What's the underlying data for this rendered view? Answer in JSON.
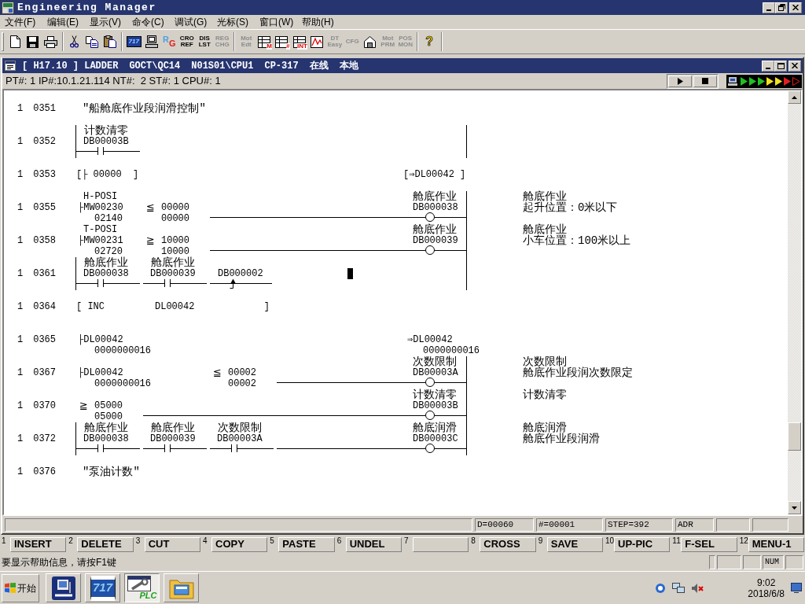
{
  "window": {
    "title": "Engineering Manager"
  },
  "menu": [
    "文件(F)",
    "编辑(E)",
    "显示(V)",
    "命令(C)",
    "调试(G)",
    "光标(S)",
    "窗口(W)",
    "帮助(H)"
  ],
  "toolbar": {
    "groups": [
      {
        "items": [
          {
            "kind": "new",
            "disabled": false
          },
          {
            "kind": "save",
            "disabled": false
          },
          {
            "kind": "print",
            "disabled": false
          }
        ]
      },
      {
        "items": [
          {
            "kind": "cut",
            "disabled": false
          },
          {
            "kind": "copy",
            "disabled": false
          },
          {
            "kind": "paste",
            "disabled": false
          }
        ]
      },
      {
        "items": [
          {
            "kind": "tile",
            "label": "717",
            "disabled": false
          },
          {
            "kind": "terminal",
            "disabled": false
          },
          {
            "kind": "letters",
            "label": "RG",
            "disabled": false
          },
          {
            "kind": "text",
            "lines": [
              "CRO",
              "REF"
            ],
            "disabled": false
          },
          {
            "kind": "text",
            "lines": [
              "DIS",
              "LST"
            ],
            "disabled": false
          },
          {
            "kind": "text",
            "lines": [
              "REG",
              "CHG"
            ],
            "disabled": true
          }
        ]
      },
      {
        "items": [
          {
            "kind": "text",
            "lines": [
              "Mot",
              "Edt"
            ],
            "disabled": true
          },
          {
            "kind": "grid",
            "label": "M",
            "disabled": false
          },
          {
            "kind": "grid",
            "label": "#",
            "disabled": false
          },
          {
            "kind": "grid",
            "label": "INT",
            "disabled": false
          },
          {
            "kind": "trend",
            "disabled": false
          },
          {
            "kind": "text",
            "lines": [
              "DT",
              "Easy"
            ],
            "disabled": true
          },
          {
            "kind": "text",
            "lines": [
              "CFG"
            ],
            "disabled": true
          },
          {
            "kind": "house",
            "disabled": false
          },
          {
            "kind": "text",
            "lines": [
              "Mot",
              "PRM"
            ],
            "disabled": true
          },
          {
            "kind": "text",
            "lines": [
              "POS",
              "MON"
            ],
            "disabled": true
          }
        ]
      },
      {
        "items": [
          {
            "kind": "help",
            "label": "?",
            "disabled": false
          }
        ]
      }
    ]
  },
  "document": {
    "title_parts": [
      "[ H17.10 ] LADDER",
      "GOCT\\QC14",
      "N01S01\\CPU1",
      "CP-317",
      "在线",
      "本地"
    ],
    "connection": "PT#: 1 IP#:10.1.21.114 NT#:  2 ST#: 1 CPU#: 1",
    "ladder": {
      "rows": [
        {
          "pt": "1",
          "step": "0351",
          "kind": "comment",
          "text": "″船舱底作业段润滑控制″",
          "left_rail": false,
          "right_rail": false,
          "cursor": false
        },
        {
          "pt": "1",
          "step": "0352",
          "kind": "rung",
          "left_rail": true,
          "right_rail": true,
          "cursor": false,
          "cells": [
            {
              "kind": "contact",
              "label": "计数清零",
              "address": "DB00003B"
            }
          ]
        },
        {
          "pt": "1",
          "step": "0353",
          "kind": "rung",
          "left_rail": false,
          "right_rail": false,
          "cursor": false,
          "cells": [
            {
              "kind": "instruction",
              "text": "[├ 00000  ]"
            }
          ],
          "output": {
            "kind": "instruction",
            "text": "[⇒DL00042 ]"
          }
        },
        {
          "pt": "1",
          "step": "0355",
          "kind": "rung",
          "left_rail": false,
          "right_rail": true,
          "cursor": false,
          "cells": [
            {
              "kind": "source",
              "label": "H-POSI",
              "address": "├MW00230",
              "value": "02140",
              "wide": false
            },
            {
              "kind": "compare",
              "operator": "≦",
              "operand": "00000",
              "value": "00000"
            }
          ],
          "output": {
            "kind": "coil",
            "label": "舱底作业",
            "address": "DB000038"
          },
          "comment": [
            "舱底作业",
            "起升位置：0米以下"
          ]
        },
        {
          "pt": "1",
          "step": "0358",
          "kind": "rung",
          "left_rail": false,
          "right_rail": true,
          "cursor": false,
          "cells": [
            {
              "kind": "source",
              "label": "T-POSI",
              "address": "├MW00231",
              "value": "02720",
              "wide": false
            },
            {
              "kind": "compare",
              "operator": "≧",
              "operand": "10000",
              "value": "10000"
            }
          ],
          "output": {
            "kind": "coil",
            "label": "舱底作业",
            "address": "DB000039"
          },
          "comment": [
            "舱底作业",
            "小车位置：100米以上"
          ]
        },
        {
          "pt": "1",
          "step": "0361",
          "kind": "rung",
          "left_rail": true,
          "right_rail": true,
          "cursor": true,
          "cells": [
            {
              "kind": "contact",
              "label": "舱底作业",
              "address": "DB000038"
            },
            {
              "kind": "contact",
              "label": "舱底作业",
              "address": "DB000039"
            },
            {
              "kind": "edge",
              "address": "DB000002"
            }
          ]
        },
        {
          "pt": "1",
          "step": "0364",
          "kind": "rung",
          "left_rail": false,
          "right_rail": false,
          "cursor": false,
          "cells": [
            {
              "kind": "instruction",
              "text": "[ INC"
            },
            {
              "kind": "operand",
              "text": "DL00042"
            },
            {
              "kind": "close",
              "text": "]"
            }
          ]
        },
        {
          "pt": "1",
          "step": "0365",
          "kind": "rung",
          "left_rail": false,
          "right_rail": false,
          "cursor": false,
          "cells": [
            {
              "kind": "source",
              "address": "├DL00042",
              "value": "0000000016",
              "wide": true
            }
          ],
          "output": {
            "kind": "store",
            "address": "⇒DL00042",
            "value": "0000000016"
          }
        },
        {
          "pt": "1",
          "step": "0367",
          "kind": "rung",
          "left_rail": false,
          "right_rail": true,
          "cursor": false,
          "cells": [
            {
              "kind": "source",
              "address": "├DL00042",
              "value": "0000000016",
              "wide": true
            },
            {
              "kind": "compare",
              "operator": "≦",
              "operand": "00002",
              "value": "00002"
            }
          ],
          "output": {
            "kind": "coil",
            "label": "次数限制",
            "address": "DB00003A"
          },
          "comment": [
            "次数限制",
            "舱底作业段润次数限定"
          ]
        },
        {
          "pt": "1",
          "step": "0370",
          "kind": "rung",
          "left_rail": false,
          "right_rail": true,
          "cursor": false,
          "cells": [
            {
              "kind": "compare",
              "operator": "≧",
              "operand": "05000",
              "value": "05000"
            }
          ],
          "output": {
            "kind": "coil",
            "label": "计数清零",
            "address": "DB00003B"
          },
          "comment": [
            "计数清零"
          ]
        },
        {
          "pt": "1",
          "step": "0372",
          "kind": "rung",
          "left_rail": true,
          "right_rail": true,
          "cursor": false,
          "cells": [
            {
              "kind": "contact",
              "label": "舱底作业",
              "address": "DB000038"
            },
            {
              "kind": "contact",
              "label": "舱底作业",
              "address": "DB000039"
            },
            {
              "kind": "contact",
              "label": "次数限制",
              "address": "DB00003A"
            }
          ],
          "output": {
            "kind": "coil",
            "label": "舱底润滑",
            "address": "DB00003C"
          },
          "comment": [
            "舱底润滑",
            "舱底作业段润滑"
          ]
        },
        {
          "pt": "1",
          "step": "0376",
          "kind": "comment",
          "text": "″泵油计数″",
          "left_rail": false,
          "right_rail": false,
          "cursor": false
        }
      ]
    },
    "status_fields": [
      "D=00060",
      "#=00001",
      "STEP=392",
      "ADR"
    ]
  },
  "function_keys": [
    {
      "number": "1",
      "label": "INSERT"
    },
    {
      "number": "2",
      "label": "DELETE"
    },
    {
      "number": "3",
      "label": "CUT"
    },
    {
      "number": "4",
      "label": "COPY"
    },
    {
      "number": "5",
      "label": "PASTE"
    },
    {
      "number": "6",
      "label": "UNDEL"
    },
    {
      "number": "7"
    },
    {
      "number": "8",
      "label": "CROSS"
    },
    {
      "number": "9",
      "label": "SAVE"
    },
    {
      "number": "10",
      "label": "UP-PIC"
    },
    {
      "number": "11",
      "label": "F-SEL"
    },
    {
      "number": "12",
      "label": "MENU-1"
    }
  ],
  "help_bar": {
    "message": "要显示帮助信息，请按F1键",
    "indicators": [
      "NUM"
    ]
  },
  "taskbar": {
    "start": "开始",
    "tasks": [
      {
        "kind": "device",
        "selected": false
      },
      {
        "kind": "tile",
        "label": "717",
        "selected": false
      },
      {
        "kind": "tool",
        "label": "PLC",
        "selected": true
      },
      {
        "kind": "folder",
        "selected": false
      }
    ],
    "clock": {
      "time": "9:02",
      "date": "2018/6/8"
    }
  }
}
